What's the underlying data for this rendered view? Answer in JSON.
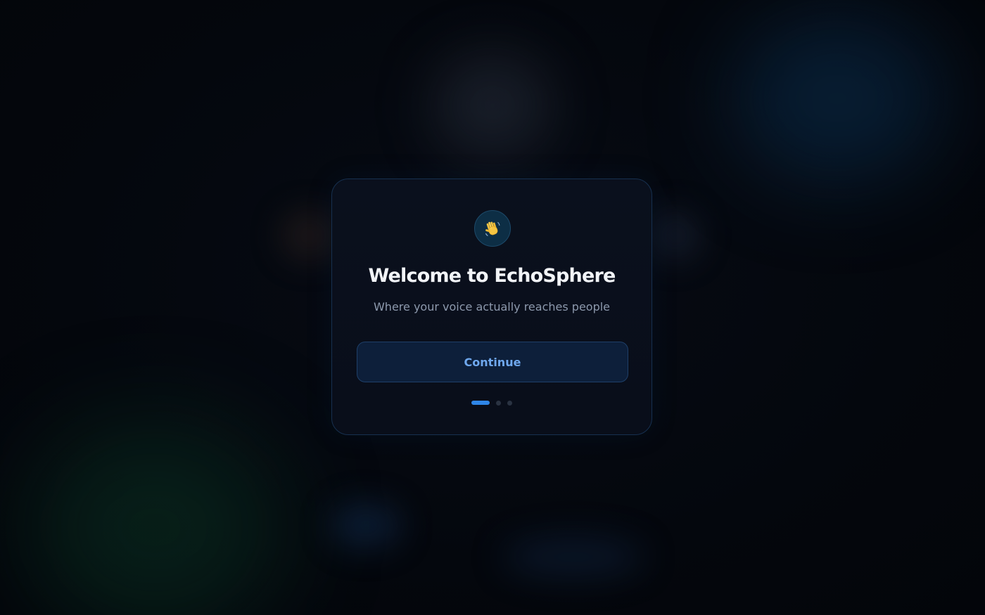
{
  "onboarding": {
    "icon": "waving-hand-icon",
    "title": "Welcome to EchoSphere",
    "subtitle": "Where your voice actually reaches people",
    "continue_label": "Continue",
    "steps": {
      "total": 3,
      "current": 1
    }
  },
  "colors": {
    "background": "#04070d",
    "card": "#0a101d",
    "card_border": "#17304f",
    "accent": "#2f86e8",
    "button_text": "#6fa8ee",
    "button_bg": "#0d1f3a",
    "title": "#f2f4f8",
    "subtitle": "#8d99ad"
  }
}
